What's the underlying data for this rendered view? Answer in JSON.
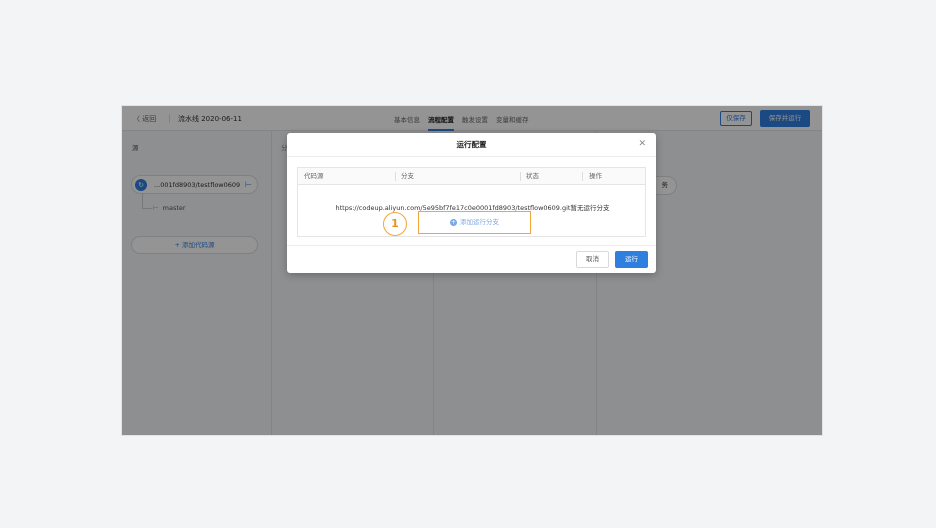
{
  "header": {
    "back_label": "〈 返回",
    "pipeline_name": "流水线 2020-06-11",
    "tabs": [
      {
        "label": "基本信息",
        "active": false
      },
      {
        "label": "流程配置",
        "active": true
      },
      {
        "label": "触发设置",
        "active": false
      },
      {
        "label": "变量和缓存",
        "active": false
      }
    ],
    "save_label": "仅保存",
    "save_run_label": "保存并运行"
  },
  "stage": {
    "source_title": "源",
    "second_title": "分",
    "source_repo": "...001fd8903/testflow0609",
    "branch": "master",
    "add_source_label": "+ 添加代码源",
    "task_suffix": "务"
  },
  "modal": {
    "title": "运行配置",
    "columns": [
      "代码源",
      "分支",
      "状态",
      "操作"
    ],
    "repo_url": "https://codeup.aliyun.com/5e95bf7fe17c0e0001fd8903/testflow0609.git暂无运行分支",
    "add_branch_label": "添加运行分支",
    "step_number": "1",
    "cancel_label": "取消",
    "run_label": "运行"
  },
  "colors": {
    "accent": "#2f7fe0",
    "highlight": "#f0a63b"
  }
}
